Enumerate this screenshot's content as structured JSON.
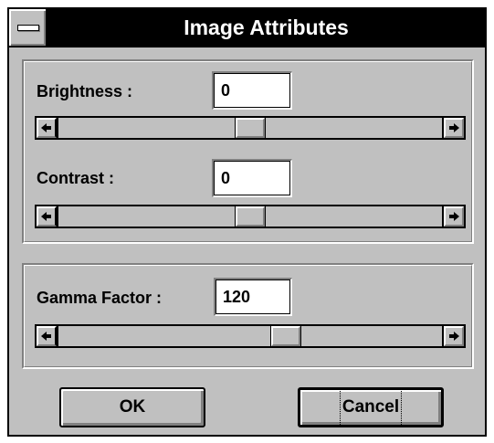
{
  "window": {
    "title": "Image Attributes"
  },
  "brightness": {
    "label": "Brightness :",
    "value": "0",
    "slider_fraction": 0.5
  },
  "contrast": {
    "label": "Contrast :",
    "value": "0",
    "slider_fraction": 0.5
  },
  "gamma": {
    "label": "Gamma Factor :",
    "value": "120",
    "slider_fraction": 0.6
  },
  "buttons": {
    "ok": "OK",
    "cancel": "Cancel"
  },
  "icons": {
    "system_menu": "system-menu-icon",
    "arrow_left": "arrow-left-icon",
    "arrow_right": "arrow-right-icon"
  },
  "colors": {
    "titlebar": "#000000",
    "face": "#c0c0c0",
    "field": "#ffffff"
  }
}
